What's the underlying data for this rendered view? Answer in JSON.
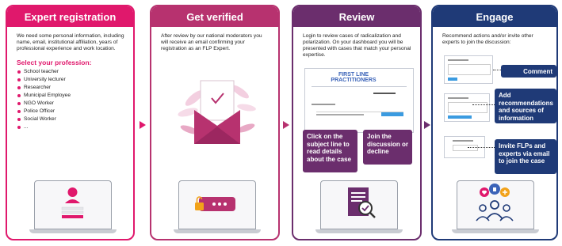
{
  "colors": {
    "step1": "#e0186c",
    "step2": "#b7326f",
    "step3": "#6b2e6d",
    "step4": "#1f3a77"
  },
  "steps": [
    {
      "title": "Expert registration",
      "text": "We need some personal information, including name, email, institutional affiliation, years of professional experience and work location.",
      "subhead": "Select your profession:",
      "professions": [
        "School teacher",
        "University lecturer",
        "Researcher",
        "Municipal Employee",
        "NGO Worker",
        "Police Officer",
        "Social Worker",
        "..."
      ]
    },
    {
      "title": "Get verified",
      "text": "After review by our national moderators you will receive an email confirming your registration as an FLP Expert."
    },
    {
      "title": "Review",
      "text": "Login to review cases of radicalization and polarization. On your dashboard you will be presented with cases that match your personal expertise.",
      "screen_logo_line1": "FIRST LINE",
      "screen_logo_line2": "PRACTITIONERS",
      "callout_left": "Click on the subject line to read details about the case",
      "callout_right": "Join the discussion or decline"
    },
    {
      "title": "Engage",
      "text": "Recommend actions and/or invite other experts to join the discussion:",
      "callouts": [
        "Comment",
        "Add recommendations and sources of information",
        "Invite FLPs and experts via email to join the case"
      ]
    }
  ]
}
